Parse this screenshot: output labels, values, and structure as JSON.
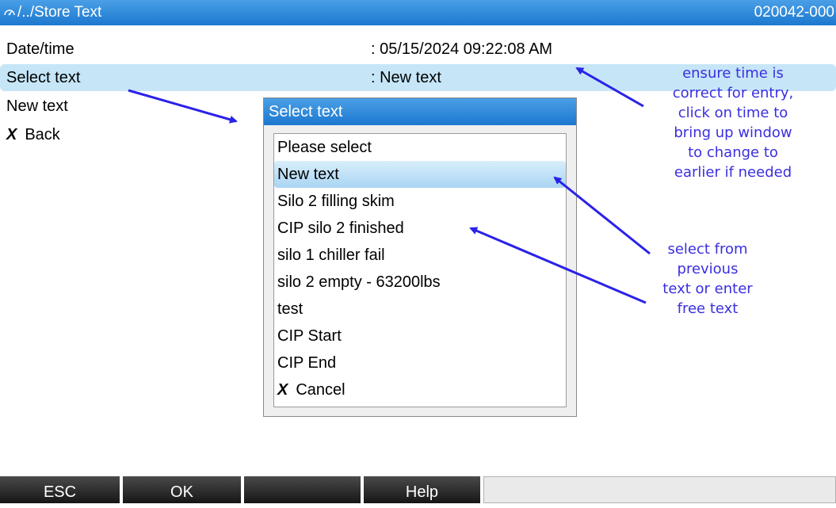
{
  "titlebar": {
    "path": "/../Store Text",
    "device_id": "020042-000",
    "icon": "gauge-icon"
  },
  "rows": {
    "datetime": {
      "label": "Date/time",
      "value": ": 05/15/2024 09:22:08 AM"
    },
    "select_text": {
      "label": "Select text",
      "value": ": New text"
    },
    "new_text": {
      "label": "New text"
    },
    "back": {
      "icon": "X",
      "label": "Back"
    }
  },
  "popup": {
    "title": "Select text",
    "items": [
      "Please select",
      "New text",
      "Silo 2 filling skim",
      "CIP silo 2 finished",
      "silo 1 chiller fail",
      "silo 2 empty - 63200lbs",
      "test",
      "CIP Start",
      "CIP End"
    ],
    "cancel": {
      "icon": "X",
      "label": "Cancel"
    },
    "selected_index": 1
  },
  "annotations": {
    "time": [
      "ensure time is",
      "correct for entry,",
      "click on time to",
      "bring up window",
      "to change to",
      "earlier if needed"
    ],
    "select": [
      "select from",
      "previous",
      "text or enter",
      "free text"
    ]
  },
  "softkeys": {
    "esc": "ESC",
    "ok": "OK",
    "blank": "",
    "help": "Help"
  },
  "colors": {
    "title_blue": "#1c78cf",
    "highlight": "#c6e6f8",
    "annotation": "#3a2ee0",
    "softkey": "#222222"
  }
}
